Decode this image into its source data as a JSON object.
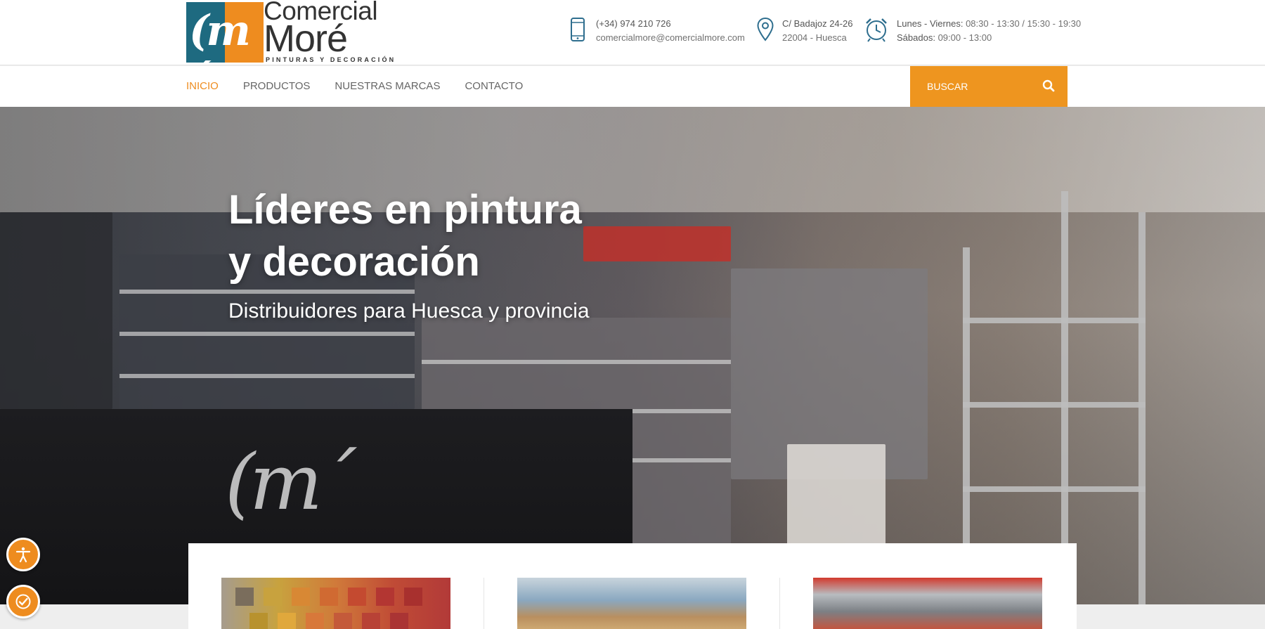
{
  "brand": {
    "logo_text_line1": "Comercial",
    "logo_text_line2": "Moré",
    "logo_tagline": "PINTURAS Y DECORACIÓN"
  },
  "contact": {
    "phone": "(+34) 974 210 726",
    "email": "comercialmore@comercialmore.com",
    "address_line1": "C/ Badajoz 24-26",
    "address_line2": "22004 - Huesca",
    "hours_weekday_label": "Lunes - Viernes:",
    "hours_weekday_value": "08:30 - 13:30 / 15:30 - 19:30",
    "hours_saturday_label": "Sábados:",
    "hours_saturday_value": "09:00 - 13:00"
  },
  "nav": {
    "items": [
      {
        "label": "INICIO",
        "active": true
      },
      {
        "label": "PRODUCTOS",
        "active": false
      },
      {
        "label": "NUESTRAS MARCAS",
        "active": false
      },
      {
        "label": "CONTACTO",
        "active": false
      }
    ],
    "search_placeholder": "BUSCAR"
  },
  "hero": {
    "title_line1": "Líderes en pintura",
    "title_line2": "y decoración",
    "subtitle": "Distribuidores para Huesca y provincia"
  },
  "icons": {
    "phone": "smartphone-icon",
    "address": "map-pin-icon",
    "hours": "alarm-clock-icon",
    "search": "search-icon",
    "accessibility": "accessibility-icon",
    "accessibility_check": "accessibility-check-icon"
  },
  "colors": {
    "accent": "#ee8c1f",
    "brand_teal": "#1e6a80",
    "icon_blue": "#2e6e8e",
    "text": "#555555"
  }
}
